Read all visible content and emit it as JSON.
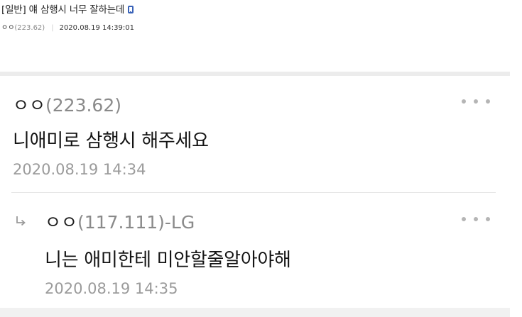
{
  "post": {
    "title": "[일반] 얘 삼행시 너무 잘하는데",
    "mobile_icon": "mobile-phone-icon",
    "author_nick": "ㅇㅇ",
    "author_ip": "(223.62)",
    "separator": "|",
    "datetime": "2020.08.19 14:39:01"
  },
  "comments": [
    {
      "nick": "ㅇㅇ",
      "ip": "(223.62)",
      "text": "니애미로 삼행시 해주세요",
      "time": "2020.08.19 14:34",
      "more_icon": "more-dots-icon"
    },
    {
      "is_reply": true,
      "reply_icon": "reply-arrow-icon",
      "nick": "ㅇㅇ",
      "ip": "(117.111)-LG",
      "text": "니는 애미한테 미안할줄알아야해",
      "time": "2020.08.19 14:35",
      "more_icon": "more-dots-icon"
    }
  ],
  "colors": {
    "accent_icon": "#3a63b8",
    "ip_text": "#8a8a8a",
    "time_text": "#9b9b9b",
    "divider": "#ececec"
  }
}
